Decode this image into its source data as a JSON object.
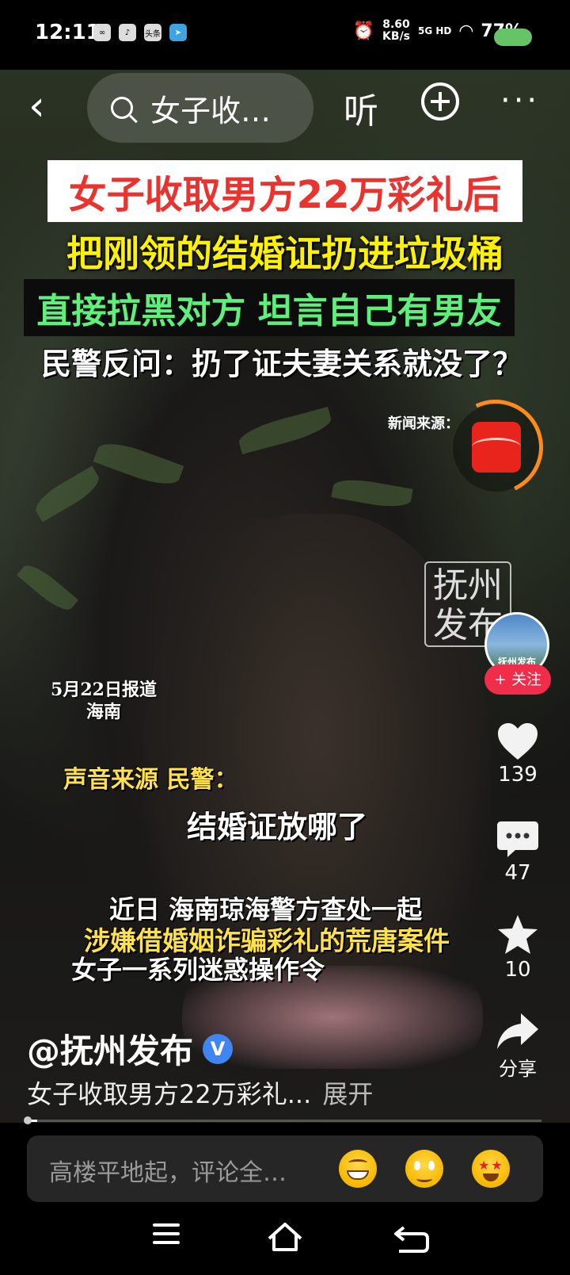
{
  "status_bar": {
    "time": "12:11",
    "app_icons": [
      "link-icon",
      "tiktok-icon",
      "toutiao-icon",
      "telegram-icon"
    ],
    "toutiao_label": "头条",
    "net_speed_value": "8.60",
    "net_speed_unit": "KB/s",
    "network": "5G HD",
    "battery": "77%",
    "battery_color": "#66c466"
  },
  "header": {
    "search_text": "女子收…",
    "listen_label": "听"
  },
  "video": {
    "caption_1": "女子收取男方22万彩礼后",
    "caption_2": "把刚领的结婚证扔进垃圾桶",
    "caption_3": "直接拉黑对方 坦言自己有男友",
    "caption_4": "民警反问：扔了证夫妻关系就没了？",
    "news_source": "新闻来源：",
    "watermark": "抚州发布",
    "report_date": "5月22日报道",
    "report_place": "海南",
    "sub_source": "声音来源 民警：",
    "sub_quote": "结婚证放哪了",
    "sub_line1": "近日 海南琼海警方查处一起",
    "sub_line2": "涉嫌借婚姻诈骗彩礼的荒唐案件",
    "sub_line3": "女子一系列迷惑操作令"
  },
  "side": {
    "avatar_text": "抚州发布",
    "follow_label": "+ 关注",
    "likes": "139",
    "comments": "47",
    "favorites": "10",
    "share_label": "分享"
  },
  "info": {
    "author": "@抚州发布",
    "verified": "V",
    "description": "女子收取男方22万彩礼...",
    "expand_label": "展开",
    "progress": 0.02
  },
  "comment_bar": {
    "placeholder": "高楼平地起，评论全…",
    "emojis": [
      "grinning-emoji",
      "smiling-emoji",
      "star-eyes-emoji"
    ]
  },
  "colors": {
    "follow": "#f02d4b",
    "caption_red": "#e8332e",
    "caption_yellow": "#fff200",
    "caption_green": "#5ef07a",
    "verified": "#3f86f0"
  }
}
